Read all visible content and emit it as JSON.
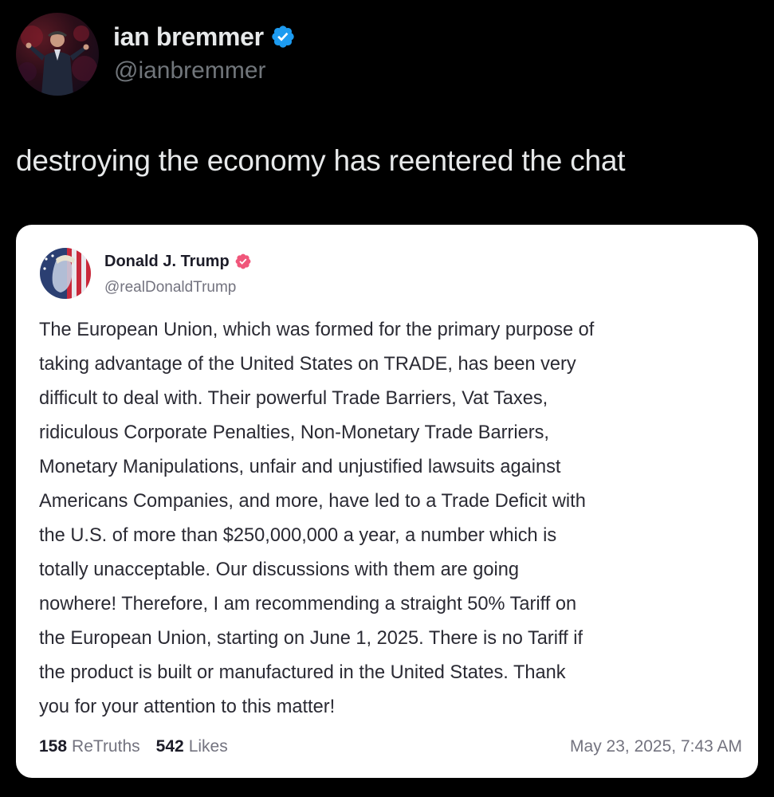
{
  "outer_post": {
    "author_name": "ian bremmer",
    "author_handle": "@ianbremmer",
    "verified_icon": "verified-badge-icon",
    "text": "destroying the economy has reentered the chat",
    "colors": {
      "background": "#000000",
      "text": "#e7e9ea",
      "muted": "#71767b",
      "verified": "#1d9bf0"
    }
  },
  "quoted_post": {
    "author_name": "Donald J. Trump",
    "author_handle": "@realDonaldTrump",
    "verified_icon": "verified-badge-icon",
    "body_lines": [
      "The European Union, which was formed for the primary purpose of",
      "taking advantage of the United States on TRADE, has been very",
      "difficult to deal with. Their powerful Trade Barriers, Vat Taxes,",
      "ridiculous Corporate Penalties, Non-Monetary Trade Barriers,",
      "Monetary Manipulations, unfair and unjustified lawsuits against",
      "Americans Companies, and more, have led to a Trade Deficit with",
      "the U.S. of more than $250,000,000 a year, a number which is",
      "totally unacceptable. Our discussions with them are going",
      "nowhere! Therefore, I am recommending a straight 50% Tariff on",
      "the European Union, starting on June 1, 2025. There is no Tariff if",
      "the product is built or manufactured in the United States. Thank",
      "you for your attention to this matter!"
    ],
    "stats": {
      "retruths_count": "158",
      "retruths_label": "ReTruths",
      "likes_count": "542",
      "likes_label": "Likes"
    },
    "timestamp": "May 23, 2025, 7:43 AM",
    "colors": {
      "background": "#ffffff",
      "text": "#2a2a33",
      "muted": "#73737f",
      "verified": "#f0567a"
    }
  }
}
